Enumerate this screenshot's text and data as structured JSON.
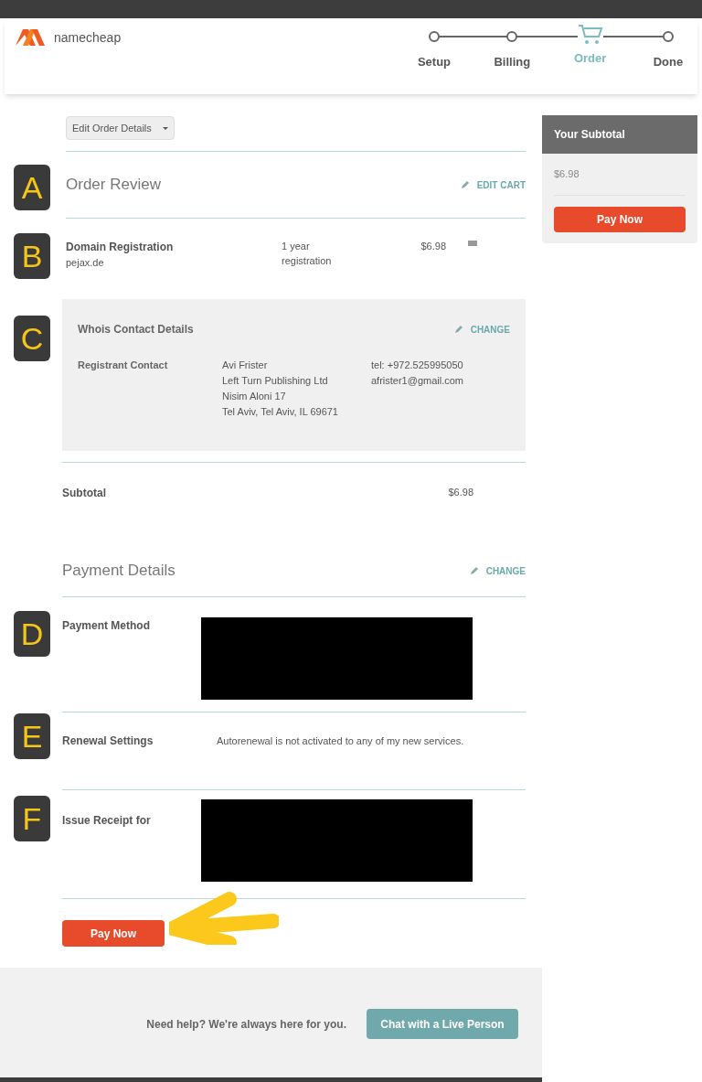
{
  "header": {
    "logo_text": "namecheap",
    "steps": [
      {
        "label": "Setup",
        "selected": false
      },
      {
        "label": "Billing",
        "selected": false
      },
      {
        "label": "Order",
        "selected": true
      },
      {
        "label": "Done",
        "selected": false
      }
    ]
  },
  "edit_order_button": "Edit Order Details",
  "order_review": {
    "title": "Order Review",
    "edit_link": "EDIT CART",
    "item": {
      "name": "Domain Registration",
      "domain": "pejax.de",
      "term": "1 year registration",
      "price": "$6.98"
    },
    "whois": {
      "title": "Whois Contact Details",
      "change_link": "CHANGE",
      "label": "Registrant Contact",
      "address": [
        "Avi Frister",
        "Left Turn Publishing Ltd",
        "Nisim Aloni 17",
        "Tel Aviv, Tel Aviv, IL 69671"
      ],
      "contact": [
        "tel: +972.525995050",
        "afrister1@gmail.com"
      ]
    },
    "subtotal_label": "Subtotal",
    "subtotal_value": "$6.98"
  },
  "payment": {
    "title": "Payment Details",
    "change_link": "CHANGE",
    "method_label": "Payment Method",
    "renewal_label": "Renewal Settings",
    "renewal_text": "Autorenewal is not activated to any of my new services.",
    "receipt_label": "Issue Receipt for"
  },
  "pay_button": "Pay Now",
  "sidebar": {
    "title": "Your Subtotal",
    "amount": "$6.98",
    "pay_button": "Pay Now"
  },
  "footer": {
    "help_text": "Need help? We're always here for you.",
    "chat_button": "Chat with a Live Person"
  },
  "annotations": [
    "A",
    "B",
    "C",
    "D",
    "E",
    "F"
  ]
}
